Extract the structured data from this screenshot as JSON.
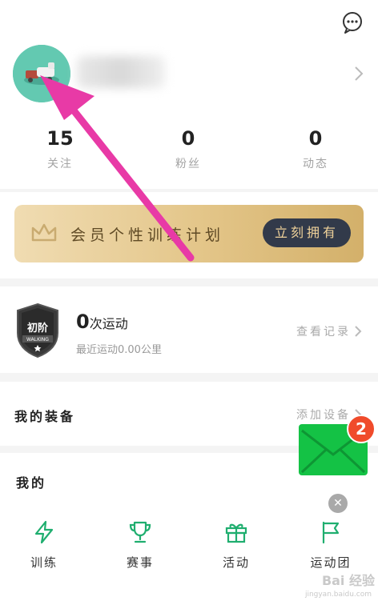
{
  "profile": {
    "stats": [
      {
        "value": "15",
        "label": "关注"
      },
      {
        "value": "0",
        "label": "粉丝"
      },
      {
        "value": "0",
        "label": "动态"
      }
    ]
  },
  "vip": {
    "text": "会员个性训练计划",
    "button": "立刻拥有"
  },
  "exercise": {
    "badge_text": "初阶",
    "badge_sub": "WALKING",
    "count": "0",
    "count_suffix": "次运动",
    "recent": "最近运动0.00公里",
    "records_link": "查看记录"
  },
  "equipment": {
    "title": "我的装备",
    "add_link": "添加设备"
  },
  "mine": {
    "title": "我的",
    "menu": [
      {
        "label": "训练",
        "icon": "lightning-icon"
      },
      {
        "label": "赛事",
        "icon": "trophy-icon"
      },
      {
        "label": "活动",
        "icon": "gift-icon"
      },
      {
        "label": "运动团",
        "icon": "flag-icon"
      }
    ]
  },
  "floating": {
    "mail_badge": "2",
    "close": "✕"
  },
  "watermark": {
    "text": "Bai 经验",
    "sub": "jingyan.baidu.com"
  },
  "colors": {
    "accent_green": "#1fae6f",
    "vip_gold": "#e3c588",
    "vip_button": "#323a4a",
    "annotation_arrow": "#e83aa6"
  }
}
